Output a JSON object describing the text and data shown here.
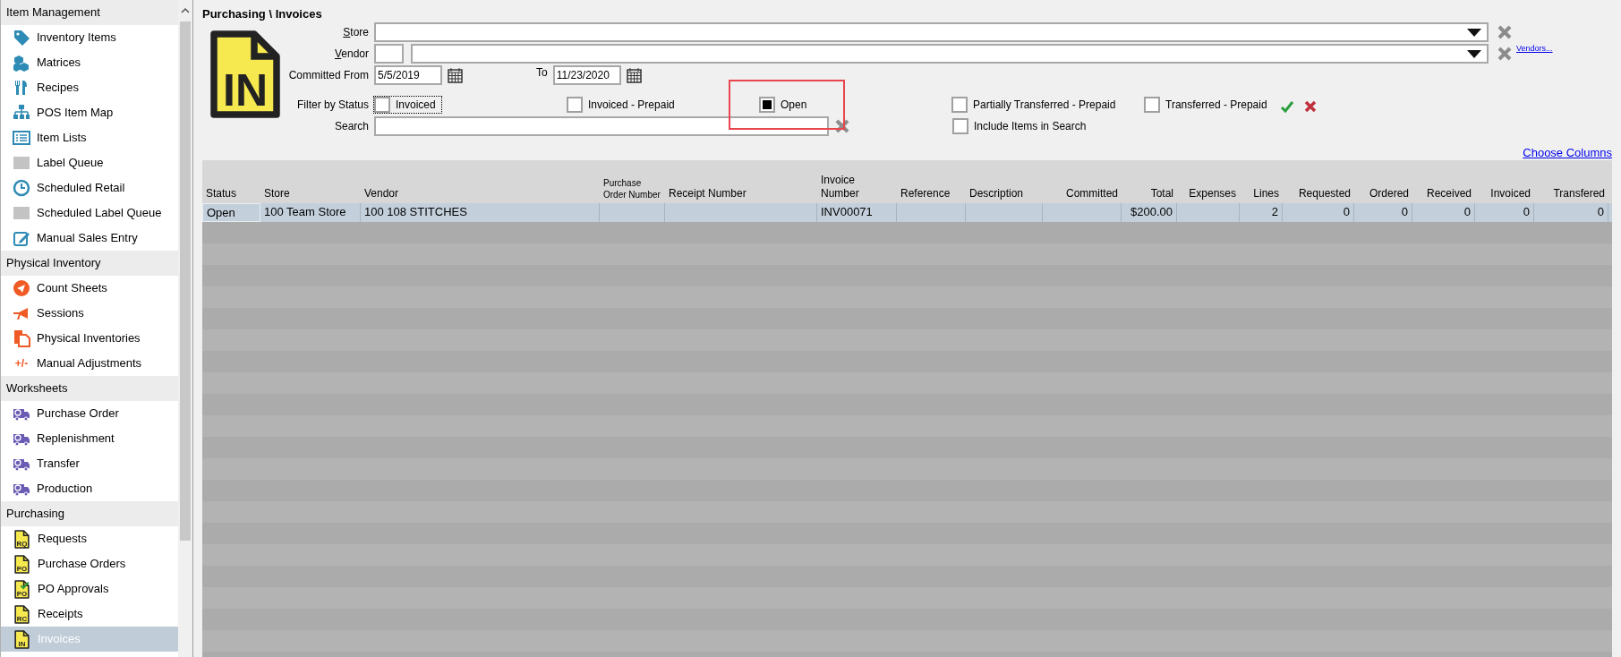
{
  "sidebar": {
    "sections": [
      {
        "title": "Item Management",
        "items": [
          {
            "label": "Inventory Items",
            "kind": "tag",
            "selected": false
          },
          {
            "label": "Matrices",
            "kind": "cubes",
            "selected": false
          },
          {
            "label": "Recipes",
            "kind": "utensils",
            "selected": false
          },
          {
            "label": "POS Item Map",
            "kind": "hierarchy",
            "selected": false
          },
          {
            "label": "Item Lists",
            "kind": "list",
            "selected": false
          },
          {
            "label": "Label Queue",
            "kind": "barcode",
            "selected": false
          },
          {
            "label": "Scheduled Retail",
            "kind": "clock",
            "selected": false
          },
          {
            "label": "Scheduled Label Queue",
            "kind": "barcode",
            "selected": false
          },
          {
            "label": "Manual Sales Entry",
            "kind": "edit",
            "selected": false
          }
        ]
      },
      {
        "title": "Physical Inventory",
        "items": [
          {
            "label": "Count Sheets",
            "kind": "send",
            "selected": false
          },
          {
            "label": "Sessions",
            "kind": "horn",
            "selected": false
          },
          {
            "label": "Physical Inventories",
            "kind": "pages",
            "selected": false
          },
          {
            "label": "Manual Adjustments",
            "kind": "glyph",
            "glyph": "+/-",
            "selected": false
          }
        ]
      },
      {
        "title": "Worksheets",
        "items": [
          {
            "label": "Purchase Order",
            "kind": "truck",
            "selected": false
          },
          {
            "label": "Replenishment",
            "kind": "truck",
            "selected": false
          },
          {
            "label": "Transfer",
            "kind": "truck",
            "selected": false
          },
          {
            "label": "Production",
            "kind": "truck",
            "selected": false
          }
        ]
      },
      {
        "title": "Purchasing",
        "items": [
          {
            "label": "Requests",
            "kind": "doc",
            "badge": "RQ",
            "selected": false
          },
          {
            "label": "Purchase Orders",
            "kind": "doc",
            "badge": "PO",
            "selected": false
          },
          {
            "label": "PO Approvals",
            "kind": "doc-check",
            "badge": "PO",
            "selected": false
          },
          {
            "label": "Receipts",
            "kind": "doc",
            "badge": "RC",
            "selected": false
          },
          {
            "label": "Invoices",
            "kind": "doc",
            "badge": "IN",
            "selected": true
          }
        ]
      }
    ]
  },
  "title": "Purchasing \\ Invoices",
  "logo": {
    "badge": "IN"
  },
  "store": {
    "label": "Store",
    "mnemonic": true
  },
  "vendor": {
    "label": "Vendor",
    "mnemonic": true,
    "link": "Vendors..."
  },
  "committed_from": {
    "label": "Committed From",
    "value": "5/5/2019"
  },
  "to": {
    "label": "To",
    "value": "11/23/2020"
  },
  "status_filter": {
    "label": "Filter by Status",
    "options": [
      {
        "label": "Invoiced",
        "checked": false,
        "focused": true,
        "highlighted": false
      },
      {
        "label": "Invoiced - Prepaid",
        "checked": false,
        "focused": false,
        "highlighted": false
      },
      {
        "label": "Open",
        "checked": true,
        "focused": false,
        "highlighted": true
      },
      {
        "label": "Partially Transferred - Prepaid",
        "checked": false,
        "focused": false,
        "highlighted": false
      },
      {
        "label": "Transferred - Prepaid",
        "checked": false,
        "focused": false,
        "highlighted": false
      }
    ]
  },
  "search": {
    "label": "Search"
  },
  "include_items": {
    "label": "Include Items in Search",
    "checked": false
  },
  "choose_columns": "Choose Columns",
  "table": {
    "columns": [
      {
        "label": "Status",
        "compact": false
      },
      {
        "label": "Store",
        "compact": false
      },
      {
        "label": "Vendor",
        "compact": false
      },
      {
        "label": "Purchase Order Number",
        "compact": true
      },
      {
        "label": "Receipt Number",
        "compact": false
      },
      {
        "label": "Invoice Number",
        "compact": false
      },
      {
        "label": "Reference",
        "compact": false
      },
      {
        "label": "Description",
        "compact": false
      },
      {
        "label": "Committed",
        "compact": false
      },
      {
        "label": "Total",
        "compact": false
      },
      {
        "label": "Expenses",
        "compact": false
      },
      {
        "label": "Lines",
        "compact": false
      },
      {
        "label": "Requested",
        "compact": false
      },
      {
        "label": "Ordered",
        "compact": false
      },
      {
        "label": "Received",
        "compact": false
      },
      {
        "label": "Invoiced",
        "compact": false
      },
      {
        "label": "Transfered",
        "compact": false
      }
    ],
    "rows": [
      {
        "selected": true,
        "cells": [
          "Open",
          "100 Team Store",
          "100 108 STITCHES",
          null,
          null,
          "INV00071",
          null,
          null,
          null,
          "$200.00",
          null,
          "2",
          "0",
          "0",
          "0",
          "0",
          "0"
        ]
      }
    ]
  }
}
